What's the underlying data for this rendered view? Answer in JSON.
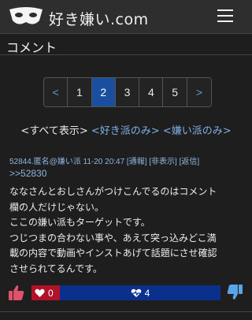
{
  "header": {
    "logo_text": "好き嫌い.com",
    "logo_icon": "mask-icon",
    "menu_icon": "hamburger-icon"
  },
  "section": {
    "title": "コメント"
  },
  "pagination": {
    "prev": "<",
    "pages": [
      "1",
      "2",
      "3",
      "4",
      "5"
    ],
    "current": "2",
    "next": ">"
  },
  "filters": {
    "show_all": "<すべて表示>",
    "likes_only": "<好き派のみ>",
    "dislikes_only": "<嫌い派のみ>"
  },
  "comment": {
    "meta": "52844.匿名@嫌い派 11-20 20:47 [通報] [非表示] [返信]",
    "reply_to": ">>52830",
    "lines": [
      "ななさんとおしさんがつけこんでるのはコメント",
      "欄の人だけじゃない。",
      "ここの嫌い派もターゲットです。",
      "つじつまの合わない事や、あえて突っ込みどこ満",
      "載の内容で動画やインストあげて話題にさせ確認",
      "させられてるんです。"
    ],
    "likes": "0",
    "dislikes": "4"
  },
  "colors": {
    "background": "#1e1e1e",
    "header": "#2e2e2e",
    "active_page": "#1a4fa0",
    "like_bar": "#b0122a",
    "dislike_bar": "#0b2f8c",
    "link": "#7fb0e8"
  }
}
